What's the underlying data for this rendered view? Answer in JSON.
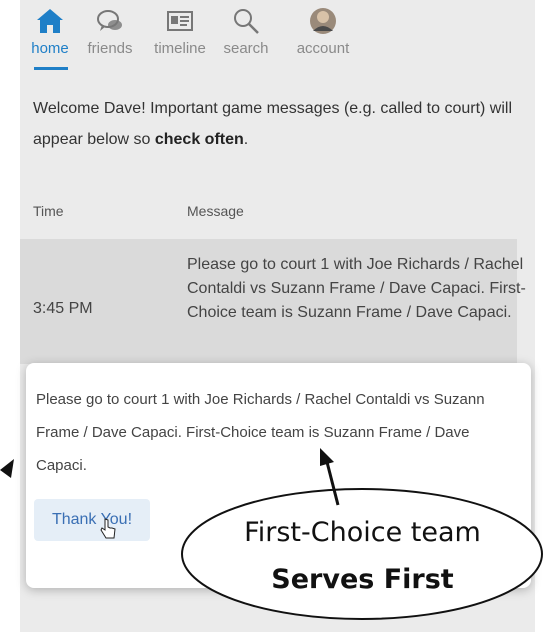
{
  "nav": {
    "items": [
      {
        "label": "home",
        "icon": "home-icon"
      },
      {
        "label": "friends",
        "icon": "chat-bubbles-icon"
      },
      {
        "label": "timeline",
        "icon": "id-card-icon"
      },
      {
        "label": "search",
        "icon": "search-icon"
      },
      {
        "label": "account",
        "icon": "avatar-icon"
      }
    ],
    "active": "home"
  },
  "welcome": {
    "text": "Welcome Dave! Important game messages (e.g. called to court) will appear below so ",
    "emphasis": "check often",
    "end": "."
  },
  "table": {
    "headers": {
      "time": "Time",
      "message": "Message"
    },
    "rows": [
      {
        "time": "3:45 PM",
        "message": "Please go to court 1 with Joe Richards / Rachel Contaldi vs Suzann Frame / Dave Capaci. First-Choice team is Suzann Frame / Dave Capaci."
      }
    ]
  },
  "dialog": {
    "text": "Please go to court 1 with Joe Richards / Rachel Contaldi vs Suzann Frame / Dave Capaci. First-Choice team is Suzann Frame / Dave Capaci.",
    "button": "Thank You!"
  },
  "annotation": {
    "line1": "First-Choice team",
    "line2": "Serves First"
  },
  "colors": {
    "accent": "#1f7fc7",
    "background": "#ebebeb",
    "button_bg": "#e5eef7"
  }
}
